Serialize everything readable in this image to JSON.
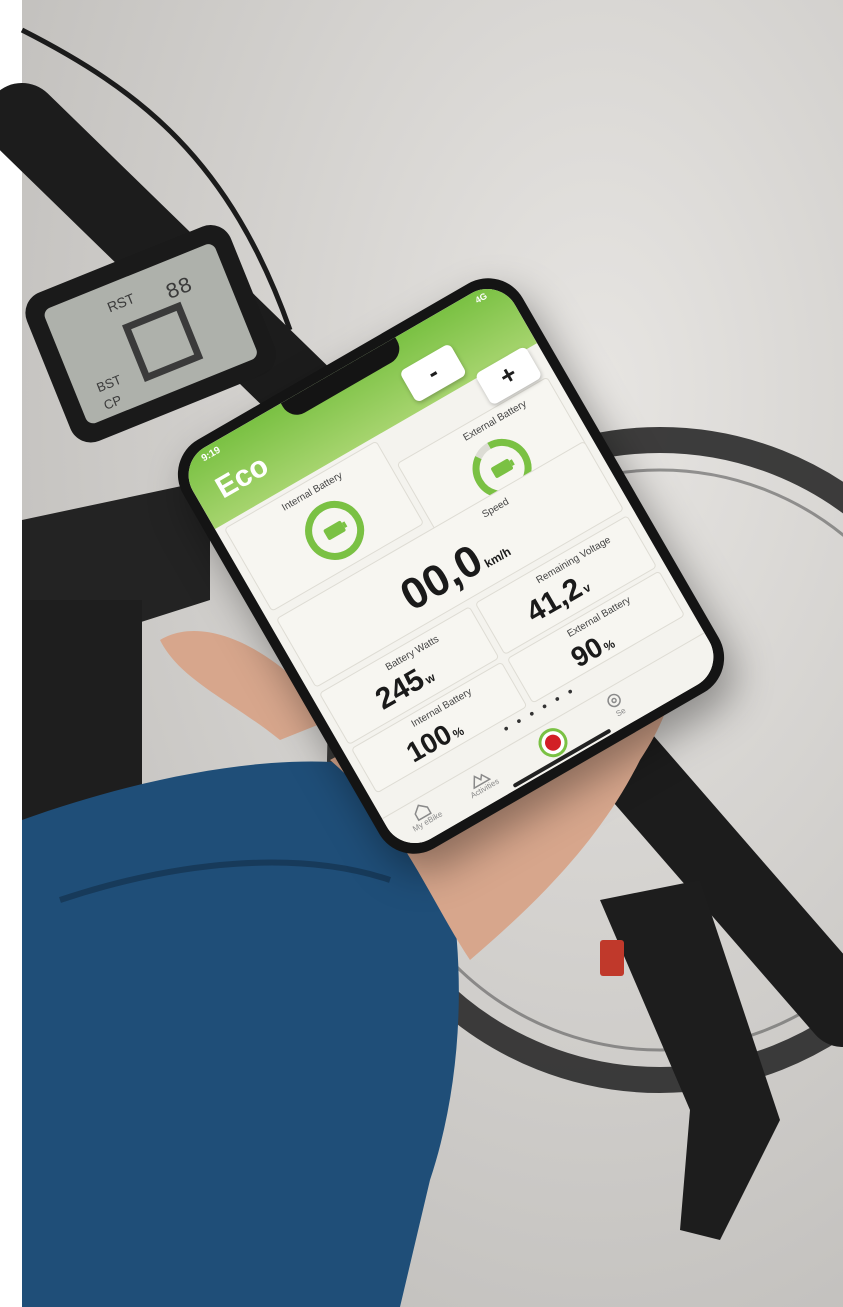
{
  "phone": {
    "status_time": "9:19",
    "status_network": "4G",
    "mode": "Eco"
  },
  "controls": {
    "minus_label": "-",
    "plus_label": "+"
  },
  "batteries": {
    "internal_label": "Internal Battery",
    "external_label": "External Battery",
    "internal_level": 1.0,
    "external_level": 0.9
  },
  "metrics": {
    "speed_label": "Speed",
    "speed_value": "00,0",
    "speed_unit": "km/h",
    "watts_label": "Battery Watts",
    "watts_value": "245",
    "watts_unit": "w",
    "voltage_label": "Remaining Voltage",
    "voltage_value": "41,2",
    "voltage_unit": "v",
    "internal_pct_label": "Internal Battery",
    "internal_pct_value": "100",
    "internal_pct_unit": "%",
    "external_pct_label": "External Battery",
    "external_pct_value": "90",
    "external_pct_unit": "%"
  },
  "nav": {
    "home_label": "My eBike",
    "activities_label": "Activities",
    "settings_label": "Se",
    "dots": "• • • • • •"
  },
  "colors": {
    "accent": "#7ac143",
    "record": "#d21f26",
    "jacket": "#1f4e78"
  },
  "bike_display": {
    "digits": "88",
    "label_rst": "RST",
    "label_bst": "BST",
    "label_cp": "CP"
  }
}
